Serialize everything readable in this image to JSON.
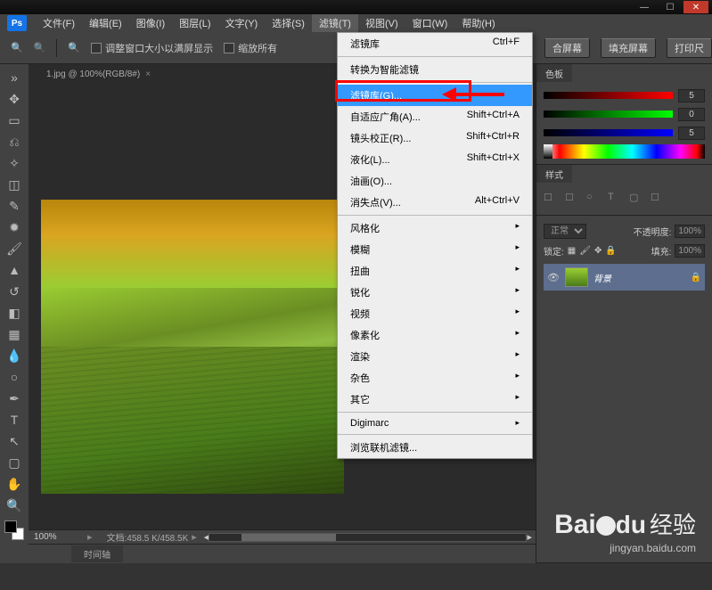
{
  "titlebar": {
    "min": "—",
    "max": "☐",
    "close": "✕"
  },
  "menubar": {
    "items": [
      {
        "label": "文件(F)"
      },
      {
        "label": "编辑(E)"
      },
      {
        "label": "图像(I)"
      },
      {
        "label": "图层(L)"
      },
      {
        "label": "文字(Y)"
      },
      {
        "label": "选择(S)"
      },
      {
        "label": "滤镜(T)",
        "active": true
      },
      {
        "label": "视图(V)"
      },
      {
        "label": "窗口(W)"
      },
      {
        "label": "帮助(H)"
      }
    ]
  },
  "options": {
    "check1": "调整窗口大小以满屏显示",
    "check2": "缩放所有",
    "btn1": "合屏幕",
    "btn2": "填充屏幕",
    "btn3": "打印尺"
  },
  "doc_tab": {
    "title": "1.jpg @ 100%(RGB/8#)",
    "close": "×"
  },
  "dropdown": {
    "items": [
      {
        "label": "滤镜库",
        "shortcut": "Ctrl+F"
      },
      {
        "sep": true
      },
      {
        "label": "转换为智能滤镜"
      },
      {
        "sep": true
      },
      {
        "label": "滤镜库(G)...",
        "highlighted": true
      },
      {
        "label": "自适应广角(A)...",
        "shortcut": "Shift+Ctrl+A"
      },
      {
        "label": "镜头校正(R)...",
        "shortcut": "Shift+Ctrl+R"
      },
      {
        "label": "液化(L)...",
        "shortcut": "Shift+Ctrl+X"
      },
      {
        "label": "油画(O)..."
      },
      {
        "label": "消失点(V)...",
        "shortcut": "Alt+Ctrl+V"
      },
      {
        "sep": true
      },
      {
        "label": "风格化",
        "submenu": true
      },
      {
        "label": "模糊",
        "submenu": true
      },
      {
        "label": "扭曲",
        "submenu": true
      },
      {
        "label": "锐化",
        "submenu": true
      },
      {
        "label": "视频",
        "submenu": true
      },
      {
        "label": "像素化",
        "submenu": true
      },
      {
        "label": "渲染",
        "submenu": true
      },
      {
        "label": "杂色",
        "submenu": true
      },
      {
        "label": "其它",
        "submenu": true
      },
      {
        "sep": true
      },
      {
        "label": "Digimarc",
        "submenu": true
      },
      {
        "sep": true
      },
      {
        "label": "浏览联机滤镜..."
      }
    ]
  },
  "panels": {
    "color": {
      "tab": "色板",
      "r": "5",
      "g": "0",
      "b": "5"
    },
    "styles": {
      "tab": "样式"
    },
    "layers": {
      "mode": "正常",
      "opacity_label": "不透明度:",
      "opacity": "100%",
      "lock_label": "锁定:",
      "fill_label": "填充:",
      "fill": "100%",
      "layer_name": "背景"
    }
  },
  "status": {
    "zoom": "100%",
    "docinfo": "文档:458.5 K/458.5K"
  },
  "timeline": {
    "label": "时间轴"
  },
  "watermark": {
    "brand": "Bai",
    "brand2": "经验",
    "url": "jingyan.baidu.com"
  }
}
